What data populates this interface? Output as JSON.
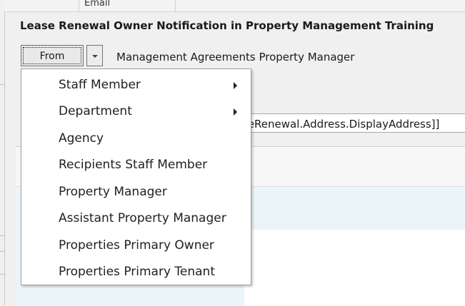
{
  "grid_header": {
    "email_label": "Email"
  },
  "title": "Lease Renewal Owner Notification in Property Management Training",
  "from_button": {
    "label": "From"
  },
  "from_value": "Management Agreements Property Manager",
  "subject_text": "seRenewal.Address.DisplayAddress]]",
  "menu": {
    "items": [
      {
        "label": "Staff Member",
        "has_submenu": true
      },
      {
        "label": "Department",
        "has_submenu": true
      },
      {
        "label": "Agency",
        "has_submenu": false
      },
      {
        "label": "Recipients Staff Member",
        "has_submenu": false
      },
      {
        "label": "Property Manager",
        "has_submenu": false
      },
      {
        "label": "Assistant Property Manager",
        "has_submenu": false
      },
      {
        "label": "Properties Primary Owner",
        "has_submenu": false
      },
      {
        "label": "Properties Primary Tenant",
        "has_submenu": false
      }
    ]
  },
  "icons": {
    "dropdown": "chevron-down-icon",
    "submenu": "chevron-right-icon"
  }
}
